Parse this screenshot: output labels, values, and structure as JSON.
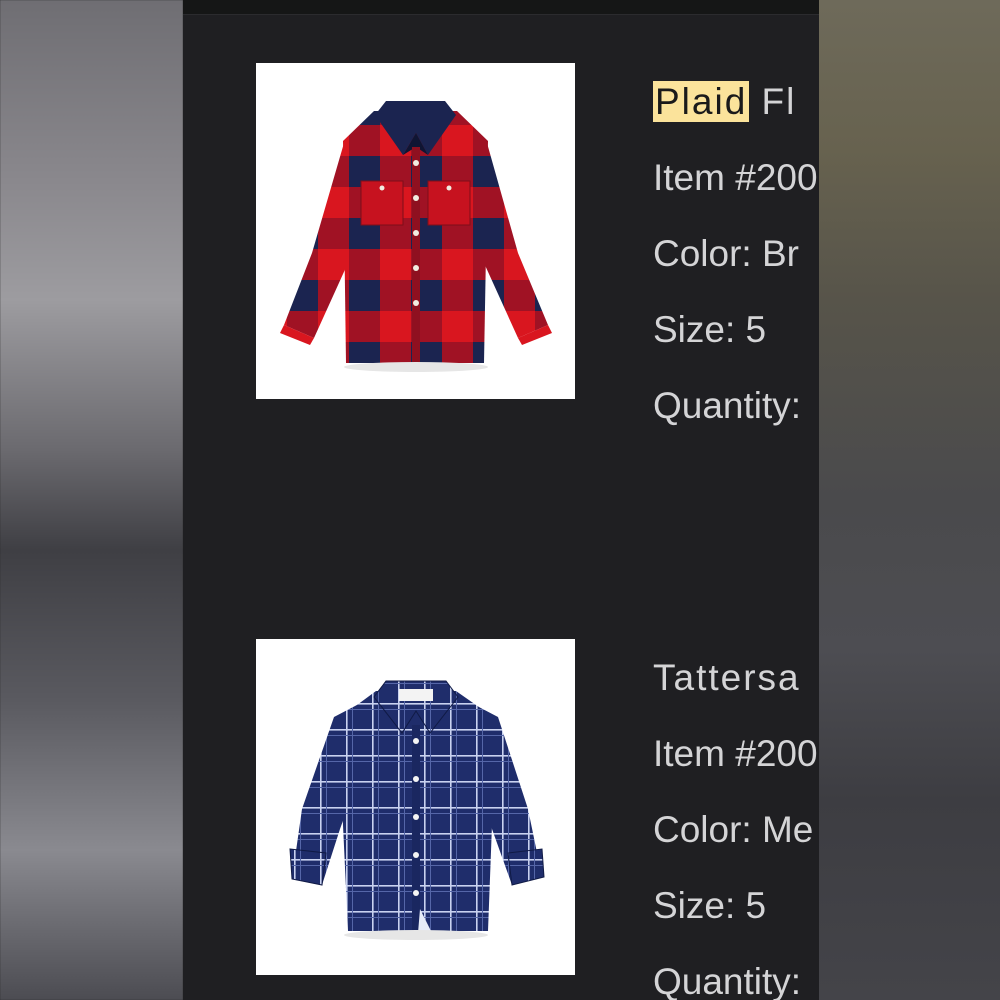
{
  "colors": {
    "highlight": "#fbe39b",
    "panel": "#1f1f22",
    "text": "#d4d4d6"
  },
  "items": [
    {
      "image_icon": "red-navy-buffalo-plaid-shirt",
      "title_highlight": "Plaid",
      "title_rest": " Fl",
      "item_no": "Item #200",
      "color": "Color: Br",
      "size": "Size: 5",
      "quantity": "Quantity:"
    },
    {
      "image_icon": "navy-windowpane-shirt",
      "title": "Tattersa",
      "item_no": "Item #200",
      "color": "Color: Me",
      "size": "Size: 5",
      "quantity": "Quantity:"
    }
  ]
}
